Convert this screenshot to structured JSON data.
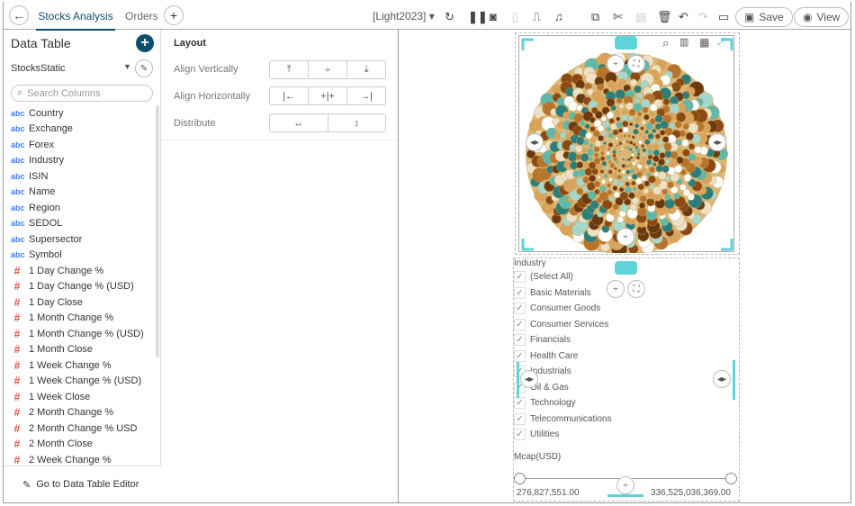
{
  "tabs": {
    "active": "Stocks Analysis",
    "other": "Orders"
  },
  "toolbar": {
    "theme": "[Light2023]",
    "save": "Save",
    "view": "View"
  },
  "left": {
    "title": "Data Table",
    "source": "StocksStatic",
    "search_placeholder": "Search Columns",
    "footer": "Go to Data Table Editor",
    "columns": [
      {
        "t": "abc",
        "n": "Country"
      },
      {
        "t": "abc",
        "n": "Exchange"
      },
      {
        "t": "abc",
        "n": "Forex"
      },
      {
        "t": "abc",
        "n": "Industry"
      },
      {
        "t": "abc",
        "n": "ISIN"
      },
      {
        "t": "abc",
        "n": "Name"
      },
      {
        "t": "abc",
        "n": "Region"
      },
      {
        "t": "abc",
        "n": "SEDOL"
      },
      {
        "t": "abc",
        "n": "Supersector"
      },
      {
        "t": "abc",
        "n": "Symbol"
      },
      {
        "t": "#",
        "n": "1 Day Change %"
      },
      {
        "t": "#",
        "n": "1 Day Change % (USD)"
      },
      {
        "t": "#",
        "n": "1 Day Close"
      },
      {
        "t": "#",
        "n": "1 Month Change %"
      },
      {
        "t": "#",
        "n": "1 Month Change % (USD)"
      },
      {
        "t": "#",
        "n": "1 Month Close"
      },
      {
        "t": "#",
        "n": "1 Week Change %"
      },
      {
        "t": "#",
        "n": "1 Week Change % (USD)"
      },
      {
        "t": "#",
        "n": "1 Week Close"
      },
      {
        "t": "#",
        "n": "2 Month Change %"
      },
      {
        "t": "#",
        "n": "2 Month Change % USD"
      },
      {
        "t": "#",
        "n": "2 Month Close"
      },
      {
        "t": "#",
        "n": "2 Week Change %"
      }
    ]
  },
  "layout": {
    "title": "Layout",
    "align_v": "Align Vertically",
    "align_h": "Align Horizontally",
    "distribute": "Distribute"
  },
  "filter": {
    "title": "Industry",
    "items": [
      "(Select All)",
      "Basic Materials",
      "Consumer Goods",
      "Consumer Services",
      "Financials",
      "Health Care",
      "Industrials",
      "Oil & Gas",
      "Technology",
      "Telecommunications",
      "Utilities"
    ],
    "range_title": "Mcap(USD)",
    "min": "276,827,551.00",
    "max": "336,525,036,369.00"
  },
  "colors": {
    "accent": "#5fd3d8",
    "brand": "#0d4f6b",
    "bubble_palette": [
      "#8b4a12",
      "#b8742a",
      "#d9a35a",
      "#ede0c4",
      "#ffffff",
      "#5fb8a8",
      "#2a7f7a",
      "#a5d8cc",
      "#6b3a10"
    ]
  }
}
